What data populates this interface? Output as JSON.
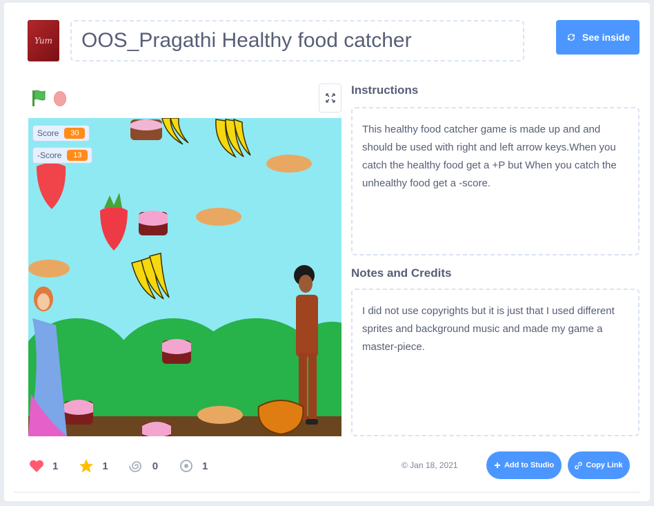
{
  "project": {
    "title": "OOS_Pragathi Healthy food catcher",
    "thumbnail_text": "Yum"
  },
  "header": {
    "see_inside_label": "See inside"
  },
  "stage": {
    "monitors": [
      {
        "label": "Score",
        "value": "30"
      },
      {
        "label": "-Score",
        "value": "13"
      }
    ]
  },
  "instructions": {
    "heading": "Instructions",
    "text": "This healthy food catcher game is made up and and should be used with right and left arrow keys.When you catch the healthy food get a +P but When you catch the unhealthy food get a -score."
  },
  "notes": {
    "heading": "Notes and Credits",
    "text": "I did not use copyrights but it is just that I used different sprites and background music and made my game a master-piece."
  },
  "stats": {
    "loves": "1",
    "favorites": "1",
    "remixes": "0",
    "views": "1"
  },
  "footer": {
    "date": "© Jan 18, 2021",
    "add_to_studio_label": "Add to Studio",
    "copy_link_label": "Copy Link"
  },
  "colors": {
    "accent": "#4c97ff",
    "monitor_value": "#ff8c1a",
    "text": "#575e75"
  },
  "icons": [
    "green-flag-icon",
    "stop-icon",
    "fullscreen-icon",
    "remix-icon",
    "heart-icon",
    "star-icon",
    "spiral-icon",
    "eye-icon",
    "plus-icon",
    "link-icon"
  ]
}
